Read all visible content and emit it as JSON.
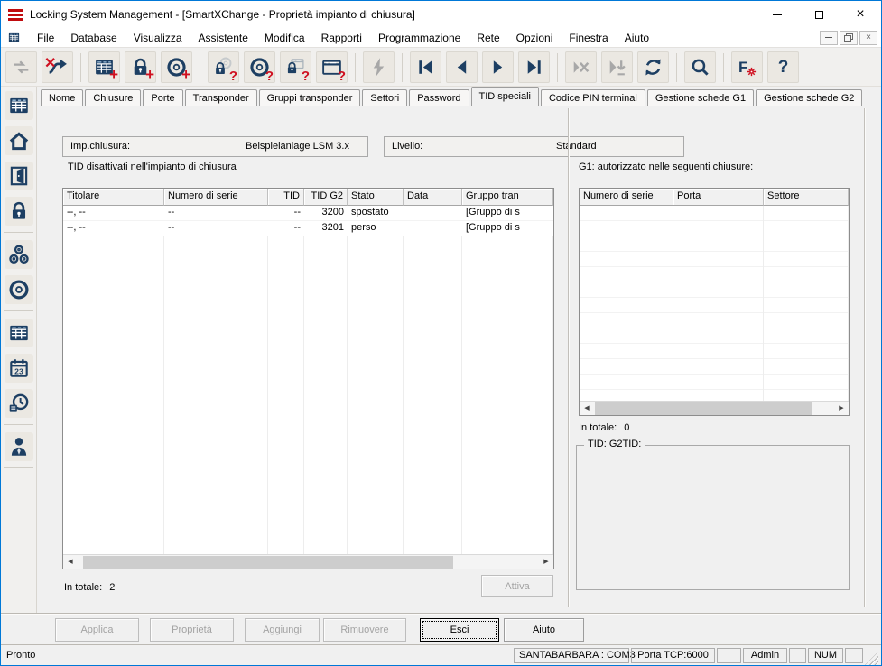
{
  "window": {
    "title": "Locking System Management - [SmartXChange - Proprietà impianto di chiusura]"
  },
  "menu": {
    "items": [
      "File",
      "Database",
      "Visualizza",
      "Assistente",
      "Modifica",
      "Rapporti",
      "Programmazione",
      "Rete",
      "Opzioni",
      "Finestra",
      "Aiuto"
    ]
  },
  "toolbar": {
    "icons": [
      "login",
      "disconnect",
      "new-locking-system",
      "new-lock",
      "new-transponder",
      "read-lock",
      "read-transponder",
      "read-lock-network",
      "read-card",
      "program",
      "first-record",
      "previous-record",
      "next-record",
      "last-record",
      "cancel",
      "jump-to",
      "refresh",
      "search",
      "filter-settings",
      "help"
    ]
  },
  "sidebar": {
    "icons": [
      "locking-system",
      "buildings",
      "doors",
      "locks",
      "transponder-groups",
      "transponders",
      "matrix-view",
      "calendar",
      "time-zone-plan",
      "users"
    ]
  },
  "tabs": {
    "items": [
      "Nome",
      "Chiusure",
      "Porte",
      "Transponder",
      "Gruppi transponder",
      "Settori",
      "Password",
      "TID speciali",
      "Codice PIN terminal",
      "Gestione schede G1",
      "Gestione schede G2"
    ],
    "active": "TID speciali"
  },
  "header_fields": {
    "system_label": "Imp.chiusura:",
    "system_value": "Beispielanlage LSM 3.x",
    "level_label": "Livello:",
    "level_value": "Standard"
  },
  "left_panel": {
    "caption": "TID disattivati nell'impianto di chiusura",
    "columns": [
      "Titolare",
      "Numero di serie",
      "TID",
      "TID G2",
      "Stato",
      "Data",
      "Gruppo tran"
    ],
    "rows": [
      [
        "--, --",
        "--",
        "--",
        "3200",
        "spostato",
        "",
        "[Gruppo di s"
      ],
      [
        "--, --",
        "--",
        "--",
        "3201",
        "perso",
        "",
        "[Gruppo di s"
      ]
    ],
    "total_label": "In totale:",
    "total_value": "2",
    "activate_button": "Attiva"
  },
  "right_panel": {
    "caption": "G1: autorizzato nelle seguenti chiusure:",
    "columns": [
      "Numero di serie",
      "Porta",
      "Settore"
    ],
    "total_label": "In totale:",
    "total_value": "0",
    "groupbox_label": "TID:  G2TID:"
  },
  "action_buttons": {
    "apply": "Applica",
    "properties": "Proprietà",
    "add": "Aggiungi",
    "remove": "Rimuovere",
    "exit": "Esci",
    "help": "Aiuto"
  },
  "statusbar": {
    "ready": "Pronto",
    "com": "SANTABARBARA : COM3",
    "tcp": "Porta TCP:6000",
    "user": "Admin",
    "num": "NUM"
  },
  "colors": {
    "accent_navy": "#1d3f63",
    "accent_red": "#cf1020",
    "window_border": "#0078d7"
  }
}
